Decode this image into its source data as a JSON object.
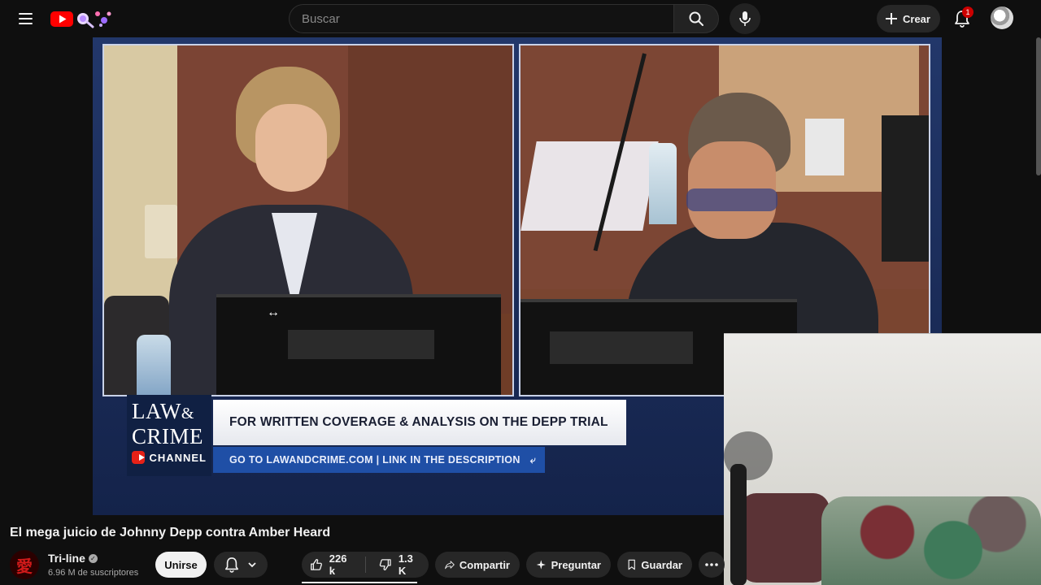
{
  "header": {
    "search_placeholder": "Buscar",
    "create_label": "Crear",
    "notification_count": "1"
  },
  "video": {
    "lower_third": {
      "logo_law": "LAW",
      "logo_amp": "&",
      "logo_crime": "CRIME",
      "logo_channel": "CHANNEL",
      "headline": "FOR WRITTEN COVERAGE & ANALYSIS ON THE DEPP TRIAL",
      "subline": "GO TO LAWANDCRIME.COM | LINK IN THE DESCRIPTION"
    }
  },
  "info": {
    "title": "El mega juicio de Johnny Depp contra Amber Heard",
    "channel_name": "Tri-line",
    "subscribers": "6.96 M de suscriptores",
    "join_label": "Unirse",
    "like_count": "226 k",
    "dislike_count": "1.3 K",
    "share_label": "Compartir",
    "ask_label": "Preguntar",
    "save_label": "Guardar"
  },
  "colors": {
    "background": "#0f0f0f",
    "pill": "#272727",
    "brand_red": "#ff0000",
    "badge_red": "#cc0000",
    "lower_third_blue": "#1f4fa6"
  },
  "icons": [
    "menu-icon",
    "youtube-logo",
    "search-icon",
    "mic-icon",
    "plus-icon",
    "bell-icon",
    "avatar",
    "verified-icon",
    "chevron-down-icon",
    "like-icon",
    "dislike-icon",
    "share-icon",
    "sparkle-icon",
    "bookmark-icon",
    "more-icon"
  ]
}
